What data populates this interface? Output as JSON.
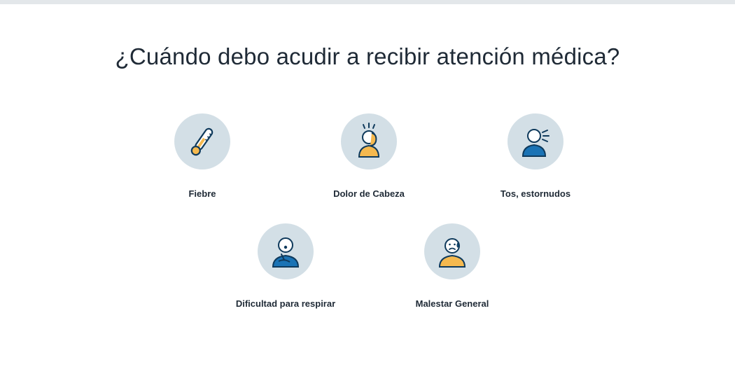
{
  "page": {
    "title": "¿Cuándo debo acudir a recibir atención médica?"
  },
  "colors": {
    "circle_bg": "#d3dfe6",
    "navy": "#0f3a5c",
    "blue": "#1a73b5",
    "orange": "#f5b94f",
    "text": "#1f2a36"
  },
  "symptoms": [
    {
      "label": "Fiebre",
      "icon": "thermometer-icon"
    },
    {
      "label": "Dolor de Cabeza",
      "icon": "headache-icon"
    },
    {
      "label": "Tos, estornudos",
      "icon": "cough-icon"
    },
    {
      "label": "Dificultad para respirar",
      "icon": "breathing-difficulty-icon"
    },
    {
      "label": "Malestar General",
      "icon": "malaise-icon"
    }
  ]
}
